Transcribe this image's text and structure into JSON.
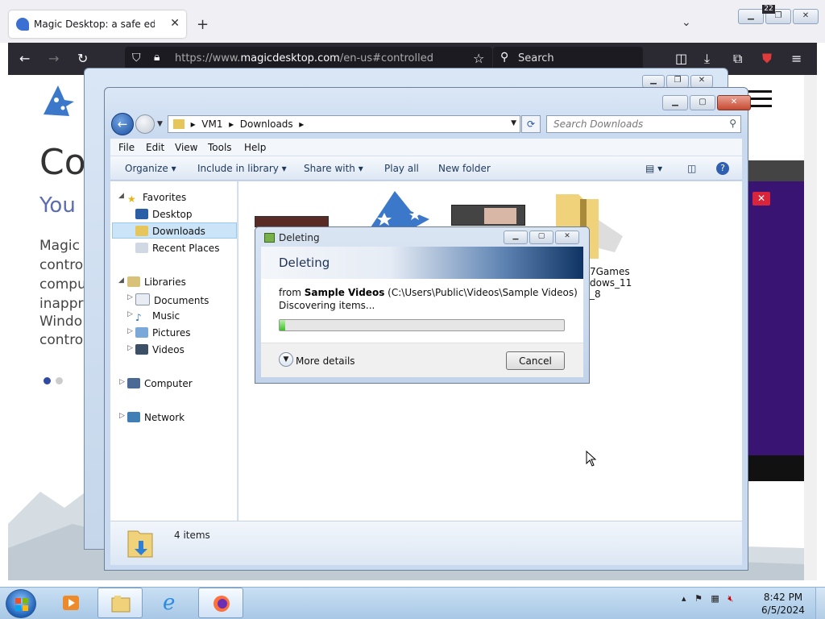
{
  "browser": {
    "tab_title": "Magic Desktop: a safe educatio",
    "new_tab": "+",
    "url_prefix": "https://www.",
    "url_domain": "magicdesktop.com",
    "url_path": "/en-us#controlled",
    "search_placeholder": "Search",
    "extension_badge": "22"
  },
  "website": {
    "heading": "Co",
    "subheading": "You",
    "paragraph_lines": [
      "Magic",
      "control",
      "compu",
      "inappro",
      "Windo",
      "control"
    ],
    "close_x": "✕"
  },
  "explorer": {
    "breadcrumb": [
      "VM1",
      "Downloads"
    ],
    "search_placeholder": "Search Downloads",
    "menu": [
      "File",
      "Edit",
      "View",
      "Tools",
      "Help"
    ],
    "commands": [
      "Organize",
      "Include in library",
      "Share with",
      "Play all",
      "New folder"
    ],
    "nav": {
      "favorites": "Favorites",
      "desktop": "Desktop",
      "downloads": "Downloads",
      "recent": "Recent Places",
      "libraries": "Libraries",
      "documents": "Documents",
      "music": "Music",
      "pictures": "Pictures",
      "videos": "Videos",
      "computer": "Computer",
      "network": "Network"
    },
    "file_label_lines": [
      "7Games",
      "dows_11",
      "_8"
    ],
    "status_count": "4 items"
  },
  "dialog": {
    "window_title": "Deleting",
    "heading": "Deleting",
    "from_prefix": "from",
    "from_name": "Sample Videos",
    "from_path": "(C:\\Users\\Public\\Videos\\Sample Videos)",
    "status": "Discovering items...",
    "progress_fraction": 0.02,
    "more_details": "More details",
    "cancel": "Cancel"
  },
  "taskbar": {
    "time": "8:42 PM",
    "date": "6/5/2024"
  }
}
